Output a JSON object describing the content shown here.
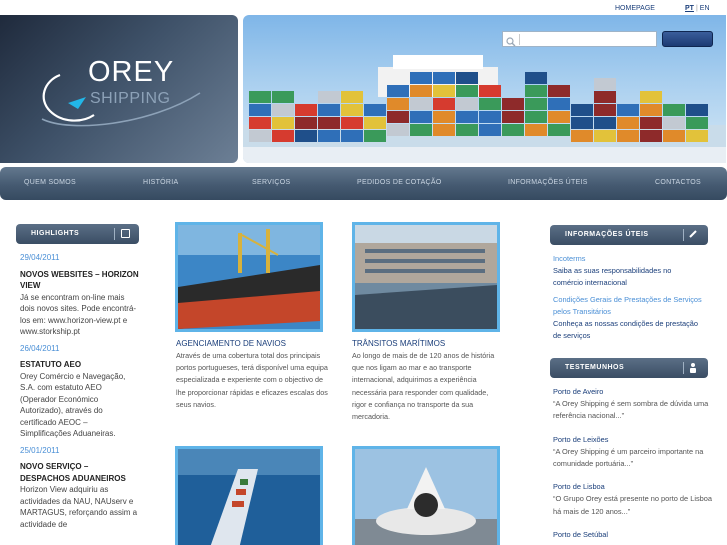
{
  "toplinks": {
    "homepage": "HOMEPAGE",
    "lang_pt": "PT",
    "lang_sep": "|",
    "lang_en": "EN"
  },
  "logo": {
    "word1": "OREY",
    "word2": "SHIPPING"
  },
  "search": {
    "placeholder": ""
  },
  "nav": [
    "QUEM SOMOS",
    "HISTÓRIA",
    "SERVIÇOS",
    "PEDIDOS DE COTAÇÃO",
    "INFORMAÇÕES ÚTEIS",
    "CONTACTOS"
  ],
  "highlights": {
    "title": "HIGHLIGHTS",
    "items": [
      {
        "date": "29/04/2011",
        "title": "NOVOS WEBSITES – HORIZON VIEW",
        "body": "Já se encontram on-line mais dois novos sites. Pode encontrá-los em: www.horizon-view.pt e www.storkship.pt"
      },
      {
        "date": "26/04/2011",
        "title": "ESTATUTO AEO",
        "body": "Orey Comércio e Navegação, S.A. com estatuto AEO (Operador Económico Autorizado), através do certificado AEOC – Simplificações Aduaneiras."
      },
      {
        "date": "25/01/2011",
        "title": "NOVO SERVIÇO – DESPACHOS ADUANEIROS",
        "body": "Horizon View adquiriu as actividades da NAU, NAUserv e MARTAGUS, reforçando assim a actividade de"
      }
    ]
  },
  "services": [
    {
      "title": "AGENCIAMENTO DE NAVIOS",
      "text": "Através de uma cobertura total dos principais portos portugueses, terá disponível uma equipa especializada e experiente com o objectivo de lhe proporcionar rápidas e eficazes escalas dos seus navios."
    },
    {
      "title": "TRÂNSITOS MARÍTIMOS",
      "text": "Ao longo de mais de de 120 anos de história que nos ligam ao mar e ao transporte internacional, adquirimos a experiência necessária para responder com qualidade, rigor e confiança no transporte da sua mercadoria."
    }
  ],
  "info": {
    "title": "INFORMAÇÕES ÚTEIS",
    "items": [
      {
        "link": "Incoterms",
        "text": "Saiba as suas responsabilidades no comércio internacional"
      },
      {
        "link": "Condições Gerais de Prestações de Serviços pelos Transitários",
        "text": "Conheça as nossas condições de prestação de serviços"
      }
    ]
  },
  "testimonials": {
    "title": "TESTEMUNHOS",
    "items": [
      {
        "port": "Porto de Aveiro",
        "quote": "“A Orey Shipping é sem sombra de dúvida uma referência nacional...”"
      },
      {
        "port": "Porto de Leixões",
        "quote": "“A Orey Shipping é um parceiro importante na comunidade portuária...”"
      },
      {
        "port": "Porto de Lisboa",
        "quote": "“O Grupo Orey está presente no porto de Lisboa há mais de 120 anos...”"
      },
      {
        "port": "Porto de Setúbal",
        "quote": ""
      }
    ]
  }
}
